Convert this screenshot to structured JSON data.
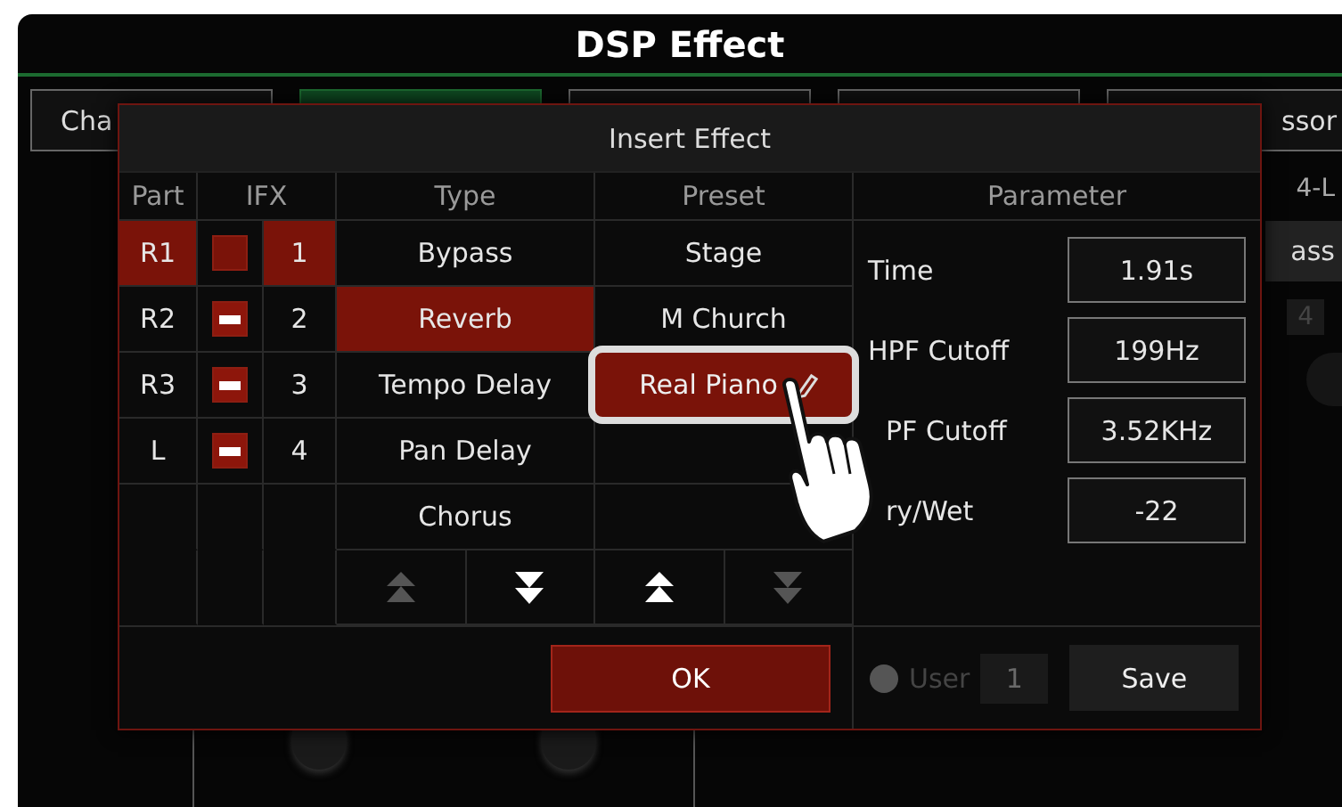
{
  "window": {
    "title": "DSP Effect"
  },
  "background": {
    "tabs": [
      {
        "label": "Cha",
        "selected": false
      },
      {
        "selected": true
      },
      {
        "selected": false
      },
      {
        "selected": false
      },
      {
        "label": "ssor",
        "selected": false
      }
    ],
    "side_label": "4-L",
    "side_button": "ass",
    "side_number": "4"
  },
  "dialog": {
    "title": "Insert Effect",
    "headers": {
      "part": "Part",
      "ifx": "IFX",
      "type": "Type",
      "preset": "Preset",
      "parameter": "Parameter"
    },
    "parts": [
      {
        "part": "R1",
        "checked": false,
        "number": "1",
        "selected": true
      },
      {
        "part": "R2",
        "checked": true,
        "number": "2",
        "selected": false
      },
      {
        "part": "R3",
        "checked": true,
        "number": "3",
        "selected": false
      },
      {
        "part": "L",
        "checked": true,
        "number": "4",
        "selected": false
      }
    ],
    "types": [
      {
        "label": "Bypass",
        "selected": false
      },
      {
        "label": "Reverb",
        "selected": true
      },
      {
        "label": "Tempo Delay",
        "selected": false
      },
      {
        "label": "Pan Delay",
        "selected": false
      },
      {
        "label": "Chorus",
        "selected": false
      }
    ],
    "type_scroll": {
      "up_disabled": true,
      "down_disabled": false
    },
    "presets": [
      {
        "label": "Stage",
        "selected": false
      },
      {
        "label": "M Church",
        "selected": false
      },
      {
        "label": "Real Piano",
        "selected": true
      }
    ],
    "preset_scroll": {
      "up_disabled": false,
      "down_disabled": true
    },
    "parameters": [
      {
        "label": "Time",
        "value": "1.91s"
      },
      {
        "label": "HPF Cutoff",
        "value": "199Hz"
      },
      {
        "label": "PF Cutoff",
        "value": "3.52KHz"
      },
      {
        "label": "ry/Wet",
        "value": "-22"
      }
    ],
    "ok": "OK",
    "user": {
      "label": "User",
      "value": "1",
      "selected": false
    },
    "save": "Save"
  }
}
